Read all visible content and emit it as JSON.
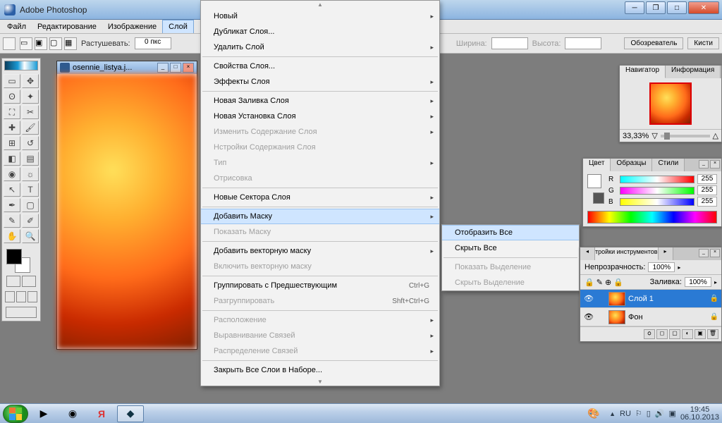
{
  "title": "Adobe Photoshop",
  "menus": [
    "Файл",
    "Редактирование",
    "Изображение",
    "Слой"
  ],
  "optbar": {
    "rastushevat": "Растушевать:",
    "rast_value": "0 пкс",
    "width_label": "Ширина:",
    "height_label": "Высота:",
    "tabs": [
      "Обозреватель",
      "Кисти"
    ]
  },
  "doc": {
    "title": "osennie_listya.j..."
  },
  "layer_menu": [
    {
      "t": "Новый",
      "sub": true
    },
    {
      "t": "Дубликат Слоя..."
    },
    {
      "t": "Удалить Слой",
      "sub": true
    },
    {
      "sep": true
    },
    {
      "t": "Свойства Слоя..."
    },
    {
      "t": "Эффекты Слоя",
      "sub": true
    },
    {
      "sep": true
    },
    {
      "t": "Новая Заливка Слоя",
      "sub": true
    },
    {
      "t": "Новая Установка Слоя",
      "sub": true
    },
    {
      "t": "Изменить Содержание Слоя",
      "sub": true,
      "dis": true
    },
    {
      "t": "Нстройки Содержания Слоя",
      "dis": true
    },
    {
      "t": "Тип",
      "sub": true,
      "dis": true
    },
    {
      "t": "Отрисовка",
      "dis": true
    },
    {
      "sep": true
    },
    {
      "t": "Новые Сектора Слоя",
      "sub": true
    },
    {
      "sep": true
    },
    {
      "t": "Добавить Маску",
      "sub": true,
      "hl": true
    },
    {
      "t": "Показать Маску",
      "dis": true
    },
    {
      "sep": true
    },
    {
      "t": "Добавить векторную маску",
      "sub": true
    },
    {
      "t": "Включить векторную маску",
      "dis": true
    },
    {
      "sep": true
    },
    {
      "t": "Группировать с Предшествующим",
      "sc": "Ctrl+G"
    },
    {
      "t": "Разгруппировать",
      "sc": "Shft+Ctrl+G",
      "dis": true
    },
    {
      "sep": true
    },
    {
      "t": "Расположение",
      "sub": true,
      "dis": true
    },
    {
      "t": "Выравнивание Связей",
      "sub": true,
      "dis": true
    },
    {
      "t": "Распределение Связей",
      "sub": true,
      "dis": true
    },
    {
      "sep": true
    },
    {
      "t": "Закрыть Все Слои в Наборе..."
    }
  ],
  "mask_submenu": [
    {
      "t": "Отобразить Все",
      "hl": true
    },
    {
      "t": "Скрыть Все"
    },
    {
      "sep": true
    },
    {
      "t": "Показать Выделение",
      "dis": true
    },
    {
      "t": "Скрыть Выделение",
      "dis": true
    }
  ],
  "navigator": {
    "tabs": [
      "Навигатор",
      "Информация"
    ],
    "zoom": "33,33%"
  },
  "colour": {
    "tabs": [
      "Цвет",
      "Образцы",
      "Стили"
    ],
    "channels": [
      {
        "c": "R",
        "val": "255",
        "grad": "linear-gradient(90deg,#0ff,#fff,#f00)"
      },
      {
        "c": "G",
        "val": "255",
        "grad": "linear-gradient(90deg,#f0f,#fff,#0f0)"
      },
      {
        "c": "B",
        "val": "255",
        "grad": "linear-gradient(90deg,#ff0,#fff,#00f)"
      }
    ]
  },
  "toolopts": {
    "title": "тройки инструментов",
    "opacity_label": "Непрозрачность:",
    "opacity_val": "100%",
    "fill_label": "Заливка:",
    "fill_val": "100%"
  },
  "layers": {
    "items": [
      {
        "name": "Слой 1",
        "sel": true,
        "lock": true
      },
      {
        "name": "Фон",
        "sel": false,
        "lock": true
      }
    ]
  },
  "tray": {
    "lang": "RU",
    "time": "19:45",
    "date": "06.10.2013"
  }
}
